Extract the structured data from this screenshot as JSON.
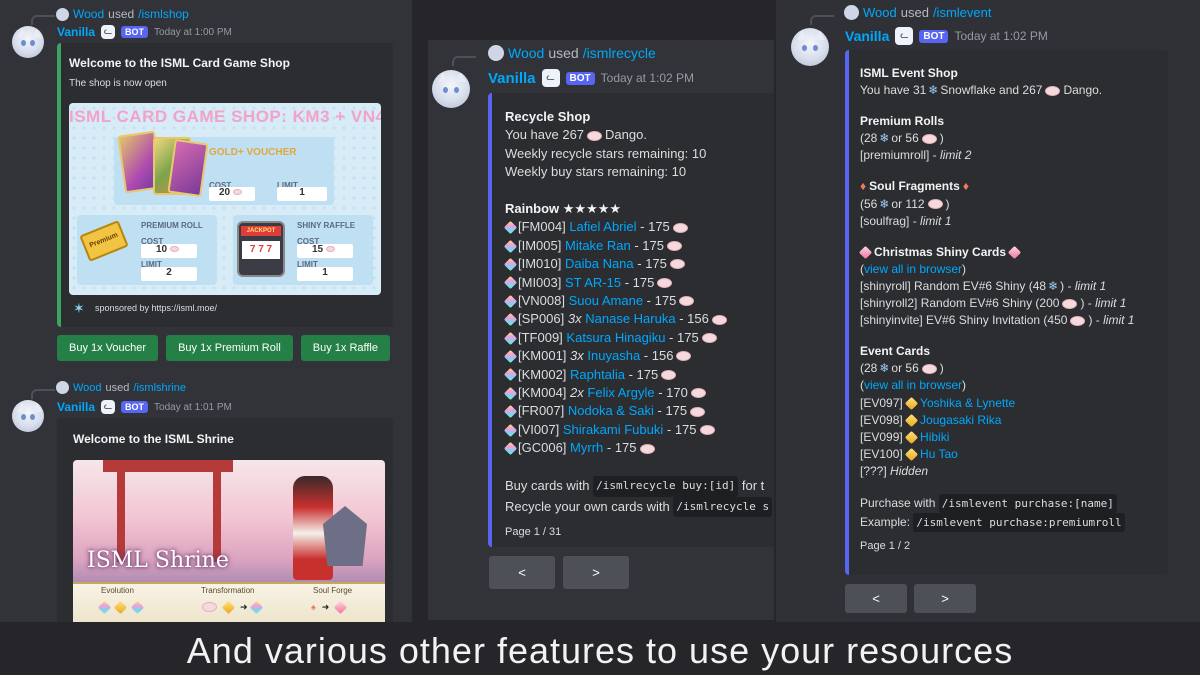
{
  "caption": "And various other features to use your resources",
  "panel1": {
    "msg1": {
      "user": "Wood",
      "used": "used",
      "command": "/ismlshop",
      "author": "Vanilla",
      "bot": "BOT",
      "time": "Today at 1:00 PM",
      "embed_title": "Welcome to the ISML Card Game Shop",
      "embed_desc": "The shop is now open",
      "image": {
        "title": "ISML CARD GAME SHOP: KM3 + VN4",
        "gold_label": "GOLD+ VOUCHER",
        "cost": "COST",
        "limit": "LIMIT",
        "gold_cost": "20",
        "gold_limit": "1",
        "premium_label": "PREMIUM ROLL",
        "premium_cost": "10",
        "premium_limit": "2",
        "premium_ticket": "Premium",
        "raffle_label": "SHINY RAFFLE",
        "raffle_cost": "15",
        "raffle_limit": "1",
        "jackpot": "JACKPOT",
        "slots": "7 7 7"
      },
      "footer": "sponsored by https://isml.moe/",
      "buttons": [
        "Buy 1x Voucher",
        "Buy 1x Premium Roll",
        "Buy 1x Raffle"
      ]
    },
    "msg2": {
      "user": "Wood",
      "used": "used",
      "command": "/ismlshrine",
      "author": "Vanilla",
      "bot": "BOT",
      "time": "Today at 1:01 PM",
      "embed_title": "Welcome to the ISML Shrine",
      "image": {
        "title": "ISML Shrine",
        "labels": [
          "Evolution",
          "Transformation",
          "Soul Forge"
        ]
      }
    }
  },
  "panel2": {
    "user": "Wood",
    "used": "used",
    "command": "/ismlrecycle",
    "author": "Vanilla",
    "bot": "BOT",
    "time": "Today at 1:02 PM",
    "title": "Recycle Shop",
    "have_pre": "You have 267",
    "have_post": "Dango.",
    "weekly_recycle": "Weekly recycle stars remaining: 10",
    "weekly_buy": "Weekly buy stars remaining: 10",
    "rainbow": "Rainbow ★★★★★",
    "cards": [
      {
        "code": "[FM004]",
        "qty": "",
        "name": "Lafiel Abriel",
        "price": "175"
      },
      {
        "code": "[IM005]",
        "qty": "",
        "name": "Mitake Ran",
        "price": "175"
      },
      {
        "code": "[IM010]",
        "qty": "",
        "name": "Daiba Nana",
        "price": "175"
      },
      {
        "code": "[MI003]",
        "qty": "",
        "name": "ST AR-15",
        "price": "175"
      },
      {
        "code": "[VN008]",
        "qty": "",
        "name": "Suou Amane",
        "price": "175"
      },
      {
        "code": "[SP006]",
        "qty": "3x",
        "name": "Nanase Haruka",
        "price": "156"
      },
      {
        "code": "[TF009]",
        "qty": "",
        "name": "Katsura Hinagiku",
        "price": "175"
      },
      {
        "code": "[KM001]",
        "qty": "3x",
        "name": "Inuyasha",
        "price": "156"
      },
      {
        "code": "[KM002]",
        "qty": "",
        "name": "Raphtalia",
        "price": "175"
      },
      {
        "code": "[KM004]",
        "qty": "2x",
        "name": "Felix Argyle",
        "price": "170"
      },
      {
        "code": "[FR007]",
        "qty": "",
        "name": "Nodoka & Saki",
        "price": "175"
      },
      {
        "code": "[VI007]",
        "qty": "",
        "name": "Shirakami Fubuki",
        "price": "175"
      },
      {
        "code": "[GC006]",
        "qty": "",
        "name": "Myrrh",
        "price": "175"
      }
    ],
    "buy_pre": "Buy cards with",
    "buy_code": "/ismlrecycle buy:[id]",
    "buy_post": "for t",
    "rec_pre": "Recycle your own cards with",
    "rec_code": "/ismlrecycle s",
    "page": "Page 1 / 31",
    "prev": "<",
    "next": ">"
  },
  "panel3": {
    "user": "Wood",
    "used": "used",
    "command": "/ismlevent",
    "author": "Vanilla",
    "bot": "BOT",
    "time": "Today at 1:02 PM",
    "title": "ISML Event Shop",
    "have_pre": "You have 31",
    "have_mid": "Snowflake and 267",
    "have_post": "Dango.",
    "premium_title": "Premium Rolls",
    "premium_price_pre": "(28",
    "premium_price_mid": "or 56",
    "premium_price_post": ")",
    "premium_cmd": "[premiumroll] -",
    "premium_limit": "limit 2",
    "soul_title": "Soul Fragments",
    "soul_price_pre": "(56",
    "soul_price_mid": "or 112",
    "soul_price_post": ")",
    "soul_cmd": "[soulfrag] -",
    "soul_limit": "limit 1",
    "xmas_title": "Christmas Shiny Cards",
    "view_pre": "(",
    "view_link": "view all in browser",
    "view_post": ")",
    "shiny1_pre": "[shinyroll] Random EV#6 Shiny (48",
    "shiny1_post": ") -",
    "shiny1_limit": "limit 1",
    "shiny2_pre": "[shinyroll2] Random EV#6 Shiny (200",
    "shiny2_post": ") -",
    "shiny2_limit": "limit 1",
    "shiny3_pre": "[shinyinvite] EV#6 Shiny Invitation (450",
    "shiny3_post": ") -",
    "shiny3_limit": "limit 1",
    "event_title": "Event Cards",
    "event_price_pre": "(28",
    "event_price_mid": "or 56",
    "event_price_post": ")",
    "event_view_pre": "(",
    "event_view_link": "view all in browser",
    "event_view_post": ")",
    "events": [
      {
        "code": "[EV097]",
        "name": "Yoshika & Lynette"
      },
      {
        "code": "[EV098]",
        "name": "Jougasaki Rika"
      },
      {
        "code": "[EV099]",
        "name": "Hibiki"
      },
      {
        "code": "[EV100]",
        "name": "Hu Tao"
      }
    ],
    "hidden_code": "[???]",
    "hidden_text": "Hidden",
    "purchase_pre": "Purchase with",
    "purchase_code": "/ismlevent purchase:[name]",
    "example_pre": "Example:",
    "example_code": "/ismlevent purchase:premiumroll",
    "page": "Page 1 / 2",
    "prev": "<",
    "next": ">"
  }
}
